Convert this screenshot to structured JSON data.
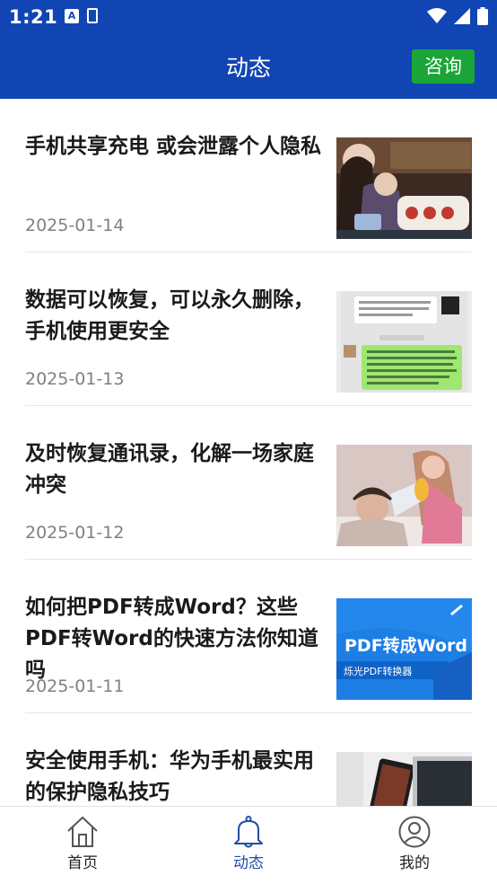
{
  "status_bar": {
    "time": "1:21"
  },
  "header": {
    "title": "动态",
    "consult_label": "咨询"
  },
  "articles": [
    {
      "title": "手机共享充电 或会泄露个人隐私",
      "date": "2025-01-14",
      "thumbnail": "people-charging-station-photo"
    },
    {
      "title": "数据可以恢复，可以永久删除，手机使用更安全",
      "date": "2025-01-13",
      "thumbnail": "chat-screenshot"
    },
    {
      "title": "及时恢复通讯录，化解一场家庭冲突",
      "date": "2025-01-12",
      "thumbnail": "megaphone-couple-photo"
    },
    {
      "title": "如何把PDF转成Word？这些PDF转Word的快速方法你知道吗",
      "date": "2025-01-11",
      "thumbnail": "pdf-to-word-banner",
      "thumb_banner": {
        "headline": "PDF转成Word",
        "tag": "烁光PDF转换器"
      }
    },
    {
      "title": "安全使用手机：华为手机最实用的保护隐私技巧",
      "date": "",
      "thumbnail": "phone-laptop-photo"
    }
  ],
  "tabbar": {
    "items": [
      {
        "label": "首页",
        "icon": "home-icon"
      },
      {
        "label": "动态",
        "icon": "bell-icon",
        "active": true
      },
      {
        "label": "我的",
        "icon": "user-icon"
      }
    ]
  },
  "colors": {
    "header_bg": "#1145b4",
    "consult_bg": "#1ba437",
    "active_tab": "#1f4ea6"
  }
}
